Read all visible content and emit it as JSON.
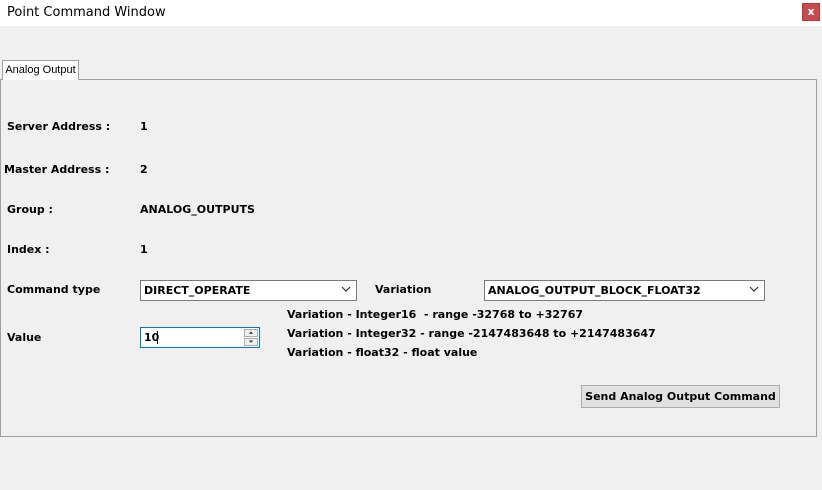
{
  "window": {
    "title": "Point Command Window",
    "close_label": "x"
  },
  "tabs": [
    {
      "label": "Analog Output",
      "active": true
    }
  ],
  "form": {
    "server_address": {
      "label": "Server Address :",
      "value": "1"
    },
    "master_address": {
      "label": "Master Address :",
      "value": "2"
    },
    "group": {
      "label": "Group :",
      "value": "ANALOG_OUTPUTS"
    },
    "index": {
      "label": "Index :",
      "value": "1"
    },
    "command_type": {
      "label": "Command type",
      "selected": "DIRECT_OPERATE"
    },
    "variation": {
      "label": "Variation",
      "selected": "ANALOG_OUTPUT_BLOCK_FLOAT32"
    },
    "value": {
      "label": "Value",
      "current": "10"
    }
  },
  "hints": [
    "Variation - Integer16  - range -32768 to +32767",
    "Variation - Integer32 - range -2147483648 to +2147483647",
    "Variation - float32 - float value"
  ],
  "actions": {
    "send_label": "Send Analog Output Command"
  },
  "colors": {
    "close_button": "#c84b4b",
    "focus_border": "#0078d7",
    "background": "#f0f0f0"
  }
}
